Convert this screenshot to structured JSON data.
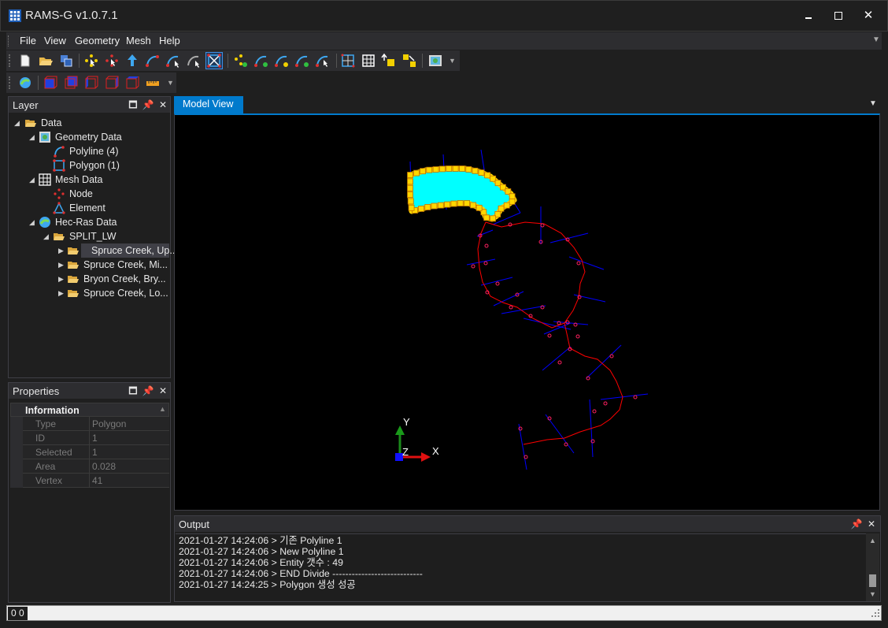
{
  "window": {
    "title": "RAMS-G v1.0.7.1"
  },
  "menu": {
    "items": [
      "File",
      "View",
      "Geometry",
      "Mesh",
      "Help"
    ]
  },
  "layer_panel": {
    "title": "Layer",
    "tree": [
      {
        "label": "Data",
        "icon": "folder-open-icon"
      },
      {
        "label": "Geometry Data",
        "icon": "geometry-data-icon"
      },
      {
        "label": "Polyline (4)",
        "icon": "polyline-icon"
      },
      {
        "label": "Polygon (1)",
        "icon": "polygon-icon"
      },
      {
        "label": "Mesh Data",
        "icon": "mesh-data-icon"
      },
      {
        "label": "Node",
        "icon": "node-icon"
      },
      {
        "label": "Element",
        "icon": "element-icon"
      },
      {
        "label": "Hec-Ras Data",
        "icon": "hecras-globe-icon"
      },
      {
        "label": "SPLIT_LW",
        "icon": "folder-open-icon"
      },
      {
        "label": "Spruce Creek, Up...",
        "icon": "folder-open-icon"
      },
      {
        "label": "Spruce Creek, Mi...",
        "icon": "folder-open-icon"
      },
      {
        "label": "Bryon Creek, Bry...",
        "icon": "folder-open-icon"
      },
      {
        "label": "Spruce Creek, Lo...",
        "icon": "folder-open-icon"
      }
    ]
  },
  "properties_panel": {
    "title": "Properties",
    "category": "Information",
    "rows": [
      {
        "key": "Type",
        "value": "Polygon"
      },
      {
        "key": "ID",
        "value": "1"
      },
      {
        "key": "Selected",
        "value": "1"
      },
      {
        "key": "Area",
        "value": "0.028"
      },
      {
        "key": "Vertex",
        "value": "41"
      }
    ]
  },
  "model_view": {
    "tab_label": "Model View",
    "axis_labels": {
      "x": "X",
      "y": "Y",
      "z": "Z"
    }
  },
  "output_panel": {
    "title": "Output",
    "lines": [
      "2021-01-27 14:24:06 > 기존 Polyline 1",
      "2021-01-27 14:24:06 > New Polyline 1",
      "2021-01-27 14:24:06 > Entity 갯수 : 49",
      "2021-01-27 14:24:06 > END Divide ----------------------------",
      "2021-01-27 14:24:25 > Polygon 생성 성공"
    ]
  },
  "status": {
    "coords": "0 0"
  },
  "colors": {
    "accent": "#007acc",
    "channel_line": "#ff0000",
    "cross_section": "#0000ff",
    "polygon_fill": "#00ffff",
    "polygon_vertex": "#ffd700"
  }
}
